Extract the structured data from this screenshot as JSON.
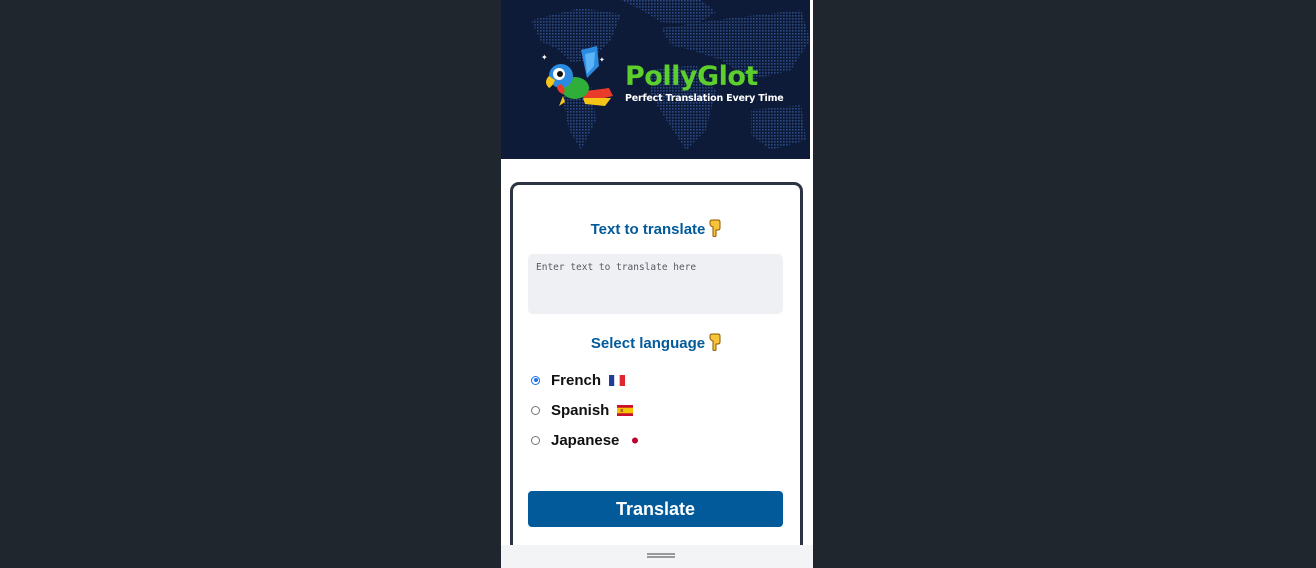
{
  "header": {
    "brand_name": "PollyGlot",
    "tagline": "Perfect Translation Every Time",
    "logo_icon": "parrot-icon",
    "background_icon": "world-map"
  },
  "form": {
    "text_section_title": "Text to translate",
    "text_section_icon": "pointing-down-hand-icon",
    "input_placeholder": "Enter text to translate here",
    "input_value": "",
    "language_section_title": "Select language",
    "language_section_icon": "pointing-down-hand-icon",
    "languages": [
      {
        "label": "French",
        "flag_icon": "france-flag-icon",
        "selected": true
      },
      {
        "label": "Spanish",
        "flag_icon": "spain-flag-icon",
        "selected": false
      },
      {
        "label": "Japanese",
        "flag_icon": "japan-flag-icon",
        "selected": false
      }
    ],
    "submit_label": "Translate"
  },
  "colors": {
    "page_background": "#20262e",
    "header_background": "#0d1a38",
    "brand_green": "#5ccf2c",
    "accent_blue": "#035a9a",
    "card_border": "#2c3444",
    "input_background": "#eff0f4"
  }
}
